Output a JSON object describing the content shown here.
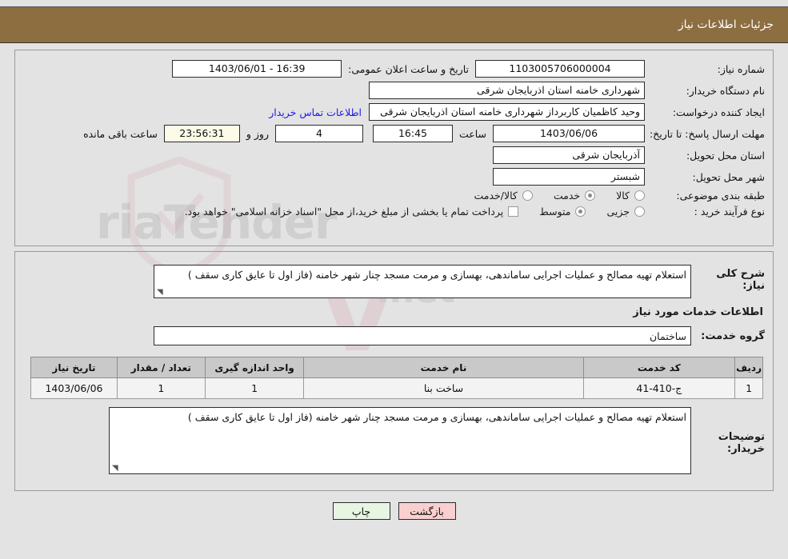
{
  "header": {
    "title": "جزئیات اطلاعات نیاز",
    "bar_color": "#8d6e41",
    "text_color": "#ffffff"
  },
  "top_form": {
    "need_number_label": "شماره نیاز:",
    "need_number_value": "1103005706000004",
    "announce_datetime_label": "تاریخ و ساعت اعلان عمومی:",
    "announce_datetime_value": "16:39 - 1403/06/01",
    "buyer_org_label": "نام دستگاه خریدار:",
    "buyer_org_value": "شهرداری خامنه استان اذربایجان شرقی",
    "creator_label": "ایجاد کننده درخواست:",
    "creator_value": "وحید کاظمیان کاربرداز شهرداری خامنه استان اذربایجان شرقی",
    "contact_link": "اطلاعات تماس خریدار",
    "contact_link_color": "#1a1ae6",
    "deadline_label": "مهلت ارسال پاسخ: تا تاریخ:",
    "deadline_date": "1403/06/06",
    "deadline_hour_label": "ساعت",
    "deadline_hour_value": "16:45",
    "remaining_days": "4",
    "remaining_days_label": "روز و",
    "remaining_clock": "23:56:31",
    "remaining_suffix": "ساعت باقی مانده",
    "province_label": "استان محل تحویل:",
    "province_value": "آذربایجان شرقی",
    "city_label": "شهر محل تحویل:",
    "city_value": "شبستر",
    "category_label": "طبقه بندی موضوعی:",
    "category_options": [
      {
        "label": "کالا",
        "selected": false
      },
      {
        "label": "خدمت",
        "selected": true
      },
      {
        "label": "کالا/خدمت",
        "selected": false
      }
    ],
    "process_label": "نوع فرآیند خرید :",
    "process_options": [
      {
        "label": "جزیی",
        "selected": false
      },
      {
        "label": "متوسط",
        "selected": true
      }
    ],
    "treasury_checkbox_label": "پرداخت تمام یا بخشی از مبلغ خرید،از محل \"اسناد خزانه اسلامی\" خواهد بود.",
    "treasury_checked": false
  },
  "brief": {
    "label": "شرح کلی نیاز:",
    "value": "استعلام تهیه مصالح و عملیات اجرایی ساماندهی، بهسازی و مرمت مسجد  چنار شهر خامنه (فاز اول تا عایق کاری سقف )"
  },
  "services_section": {
    "title": "اطلاعات خدمات مورد نیاز",
    "group_label": "گروه خدمت:",
    "group_value": "ساختمان",
    "table": {
      "columns": [
        "ردیف",
        "کد خدمت",
        "نام خدمت",
        "واحد اندازه گیری",
        "تعداد / مقدار",
        "تاریخ نیاز"
      ],
      "rows": [
        {
          "radif": "1",
          "code": "ج-410-41",
          "name": "ساخت بنا",
          "unit": "1",
          "qty": "1",
          "date": "1403/06/06"
        }
      ]
    }
  },
  "buyer_notes": {
    "label": "توضیحات خریدار:",
    "value": "استعلام تهیه مصالح و عملیات اجرایی ساماندهی، بهسازی و مرمت مسجد  چنار شهر خامنه (فاز اول تا عایق کاری سقف )"
  },
  "footer": {
    "print_label": "چاپ",
    "back_label": "بازگشت",
    "print_color": "#e7f5e3",
    "back_color": "#f9cfcf"
  },
  "watermark": {
    "text": "AriaTender.net",
    "part1": "riaTender",
    "part2": ".net"
  }
}
